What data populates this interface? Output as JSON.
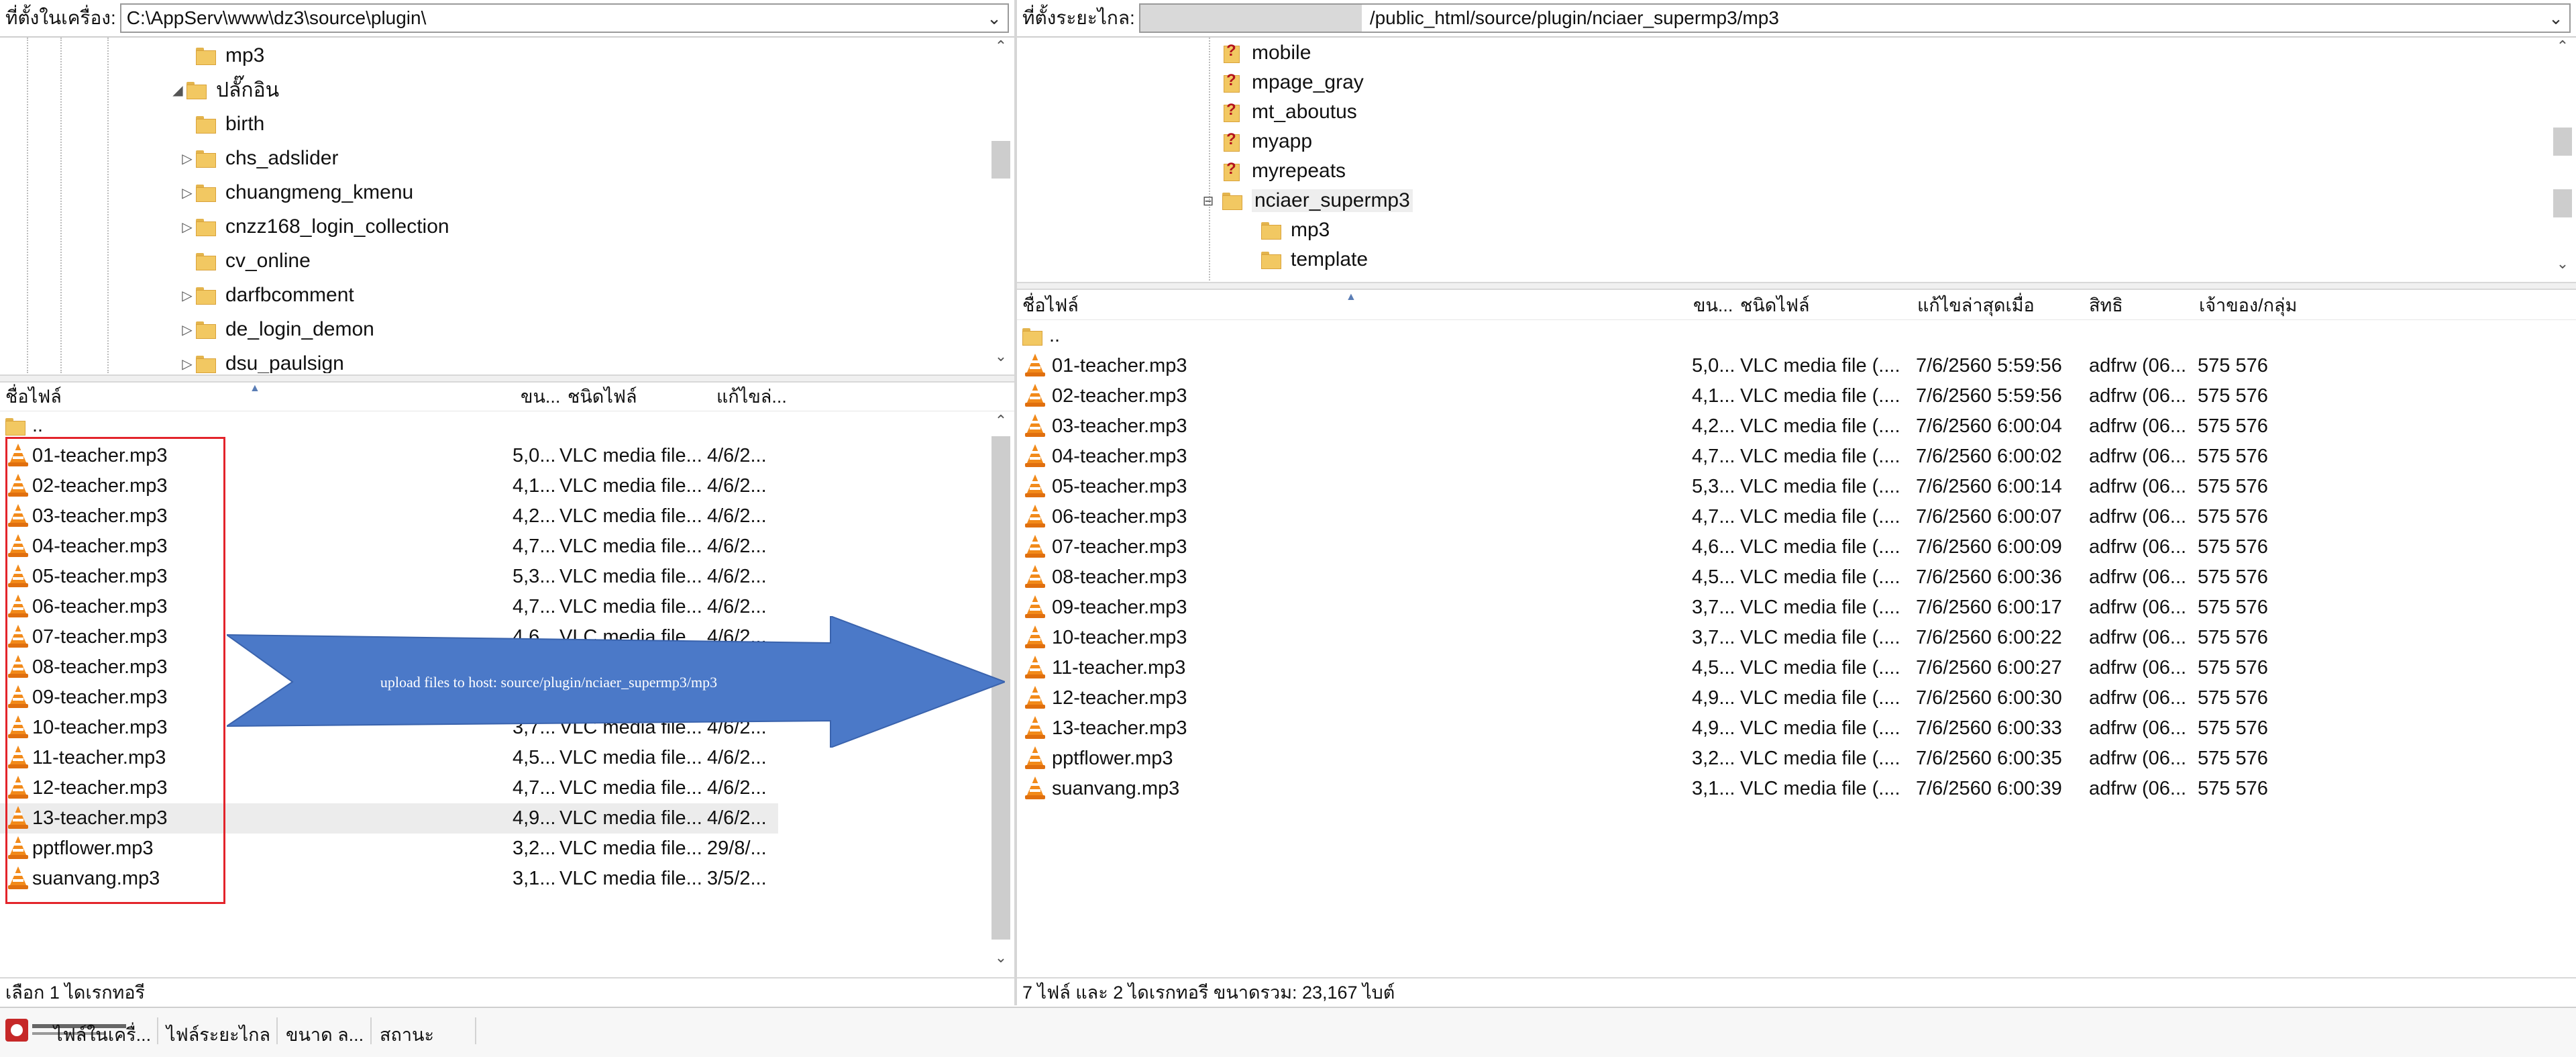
{
  "left": {
    "path_label": "ที่ตั้งในเครื่อง:",
    "path_value": "C:\\AppServ\\www\\dz3\\source\\plugin\\",
    "tree": [
      {
        "label": "mp3",
        "indent": 2,
        "expander": ""
      },
      {
        "label": "ปลั๊กอิน",
        "indent": 1,
        "expander": "◢"
      },
      {
        "label": "birth",
        "indent": 2,
        "expander": ""
      },
      {
        "label": "chs_adslider",
        "indent": 2,
        "expander": "▷"
      },
      {
        "label": "chuangmeng_kmenu",
        "indent": 2,
        "expander": "▷"
      },
      {
        "label": "cnzz168_login_collection",
        "indent": 2,
        "expander": "▷"
      },
      {
        "label": "cv_online",
        "indent": 2,
        "expander": ""
      },
      {
        "label": "darfbcomment",
        "indent": 2,
        "expander": "▷"
      },
      {
        "label": "de_login_demon",
        "indent": 2,
        "expander": "▷"
      },
      {
        "label": "dsu_paulsign",
        "indent": 2,
        "expander": "▷"
      }
    ],
    "columns": {
      "name": "ชื่อไฟล์",
      "size": "ขน...",
      "type": "ชนิดไฟล์",
      "modified": "แก้ไขล่..."
    },
    "parent_dir": "..",
    "files": [
      {
        "name": "01-teacher.mp3",
        "size": "5,0...",
        "type": "VLC media file...",
        "modified": "4/6/2..."
      },
      {
        "name": "02-teacher.mp3",
        "size": "4,1...",
        "type": "VLC media file...",
        "modified": "4/6/2..."
      },
      {
        "name": "03-teacher.mp3",
        "size": "4,2...",
        "type": "VLC media file...",
        "modified": "4/6/2..."
      },
      {
        "name": "04-teacher.mp3",
        "size": "4,7...",
        "type": "VLC media file...",
        "modified": "4/6/2..."
      },
      {
        "name": "05-teacher.mp3",
        "size": "5,3...",
        "type": "VLC media file...",
        "modified": "4/6/2..."
      },
      {
        "name": "06-teacher.mp3",
        "size": "4,7...",
        "type": "VLC media file...",
        "modified": "4/6/2..."
      },
      {
        "name": "07-teacher.mp3",
        "size": "4,6...",
        "type": "VLC media file...",
        "modified": "4/6/2..."
      },
      {
        "name": "08-teacher.mp3",
        "size": "",
        "type": "",
        "modified": ""
      },
      {
        "name": "09-teacher.mp3",
        "size": "",
        "type": "",
        "modified": ""
      },
      {
        "name": "10-teacher.mp3",
        "size": "3,7...",
        "type": "VLC media file...",
        "modified": "4/6/2..."
      },
      {
        "name": "11-teacher.mp3",
        "size": "4,5...",
        "type": "VLC media file...",
        "modified": "4/6/2..."
      },
      {
        "name": "12-teacher.mp3",
        "size": "4,7...",
        "type": "VLC media file...",
        "modified": "4/6/2..."
      },
      {
        "name": "13-teacher.mp3",
        "size": "4,9...",
        "type": "VLC media file...",
        "modified": "4/6/2..."
      },
      {
        "name": "pptflower.mp3",
        "size": "3,2...",
        "type": "VLC media file...",
        "modified": "29/8/..."
      },
      {
        "name": "suanvang.mp3",
        "size": "3,1...",
        "type": "VLC media file...",
        "modified": "3/5/2..."
      }
    ],
    "status": "เลือก 1 ไดเรกทอรี"
  },
  "right": {
    "path_label": "ที่ตั้งระยะไกล:",
    "path_value": "/public_html/source/plugin/nciaer_supermp3/mp3",
    "tree": [
      {
        "label": "mobile",
        "kind": "unknown"
      },
      {
        "label": "mpage_gray",
        "kind": "unknown"
      },
      {
        "label": "mt_aboutus",
        "kind": "unknown"
      },
      {
        "label": "myapp",
        "kind": "unknown"
      },
      {
        "label": "myrepeats",
        "kind": "unknown"
      },
      {
        "label": "nciaer_supermp3",
        "kind": "folder"
      },
      {
        "label": "mp3",
        "kind": "folder"
      },
      {
        "label": "template",
        "kind": "folder"
      }
    ],
    "columns": {
      "name": "ชื่อไฟล์",
      "size": "ขน...",
      "type": "ชนิดไฟล์",
      "modified": "แก้ไขล่าสุดเมื่อ",
      "perms": "สิทธิ",
      "owner": "เจ้าของ/กลุ่ม"
    },
    "parent_dir": "..",
    "files": [
      {
        "name": "01-teacher.mp3",
        "size": "5,0...",
        "type": "VLC media file (....",
        "modified": "7/6/2560 5:59:56",
        "perms": "adfrw (06...",
        "owner": "575 576"
      },
      {
        "name": "02-teacher.mp3",
        "size": "4,1...",
        "type": "VLC media file (....",
        "modified": "7/6/2560 5:59:56",
        "perms": "adfrw (06...",
        "owner": "575 576"
      },
      {
        "name": "03-teacher.mp3",
        "size": "4,2...",
        "type": "VLC media file (....",
        "modified": "7/6/2560 6:00:04",
        "perms": "adfrw (06...",
        "owner": "575 576"
      },
      {
        "name": "04-teacher.mp3",
        "size": "4,7...",
        "type": "VLC media file (....",
        "modified": "7/6/2560 6:00:02",
        "perms": "adfrw (06...",
        "owner": "575 576"
      },
      {
        "name": "05-teacher.mp3",
        "size": "5,3...",
        "type": "VLC media file (....",
        "modified": "7/6/2560 6:00:14",
        "perms": "adfrw (06...",
        "owner": "575 576"
      },
      {
        "name": "06-teacher.mp3",
        "size": "4,7...",
        "type": "VLC media file (....",
        "modified": "7/6/2560 6:00:07",
        "perms": "adfrw (06...",
        "owner": "575 576"
      },
      {
        "name": "07-teacher.mp3",
        "size": "4,6...",
        "type": "VLC media file (....",
        "modified": "7/6/2560 6:00:09",
        "perms": "adfrw (06...",
        "owner": "575 576"
      },
      {
        "name": "08-teacher.mp3",
        "size": "4,5...",
        "type": "VLC media file (....",
        "modified": "7/6/2560 6:00:36",
        "perms": "adfrw (06...",
        "owner": "575 576"
      },
      {
        "name": "09-teacher.mp3",
        "size": "3,7...",
        "type": "VLC media file (....",
        "modified": "7/6/2560 6:00:17",
        "perms": "adfrw (06...",
        "owner": "575 576"
      },
      {
        "name": "10-teacher.mp3",
        "size": "3,7...",
        "type": "VLC media file (....",
        "modified": "7/6/2560 6:00:22",
        "perms": "adfrw (06...",
        "owner": "575 576"
      },
      {
        "name": "11-teacher.mp3",
        "size": "4,5...",
        "type": "VLC media file (....",
        "modified": "7/6/2560 6:00:27",
        "perms": "adfrw (06...",
        "owner": "575 576"
      },
      {
        "name": "12-teacher.mp3",
        "size": "4,9...",
        "type": "VLC media file (....",
        "modified": "7/6/2560 6:00:30",
        "perms": "adfrw (06...",
        "owner": "575 576"
      },
      {
        "name": "13-teacher.mp3",
        "size": "4,9...",
        "type": "VLC media file (....",
        "modified": "7/6/2560 6:00:33",
        "perms": "adfrw (06...",
        "owner": "575 576"
      },
      {
        "name": "pptflower.mp3",
        "size": "3,2...",
        "type": "VLC media file (....",
        "modified": "7/6/2560 6:00:35",
        "perms": "adfrw (06...",
        "owner": "575 576"
      },
      {
        "name": "suanvang.mp3",
        "size": "3,1...",
        "type": "VLC media file (....",
        "modified": "7/6/2560 6:00:39",
        "perms": "adfrw (06...",
        "owner": "575 576"
      }
    ],
    "status": "7 ไฟล์ และ 2 ไดเรกทอรี ขนาดรวม: 23,167 ไบต์"
  },
  "annotation": {
    "arrow_text": "upload files to host: source/plugin/nciaer_supermp3/mp3",
    "arrow_color": "#4b79c8",
    "box_color": "#e3242b"
  },
  "queue": {
    "col1": "ไฟล์ในเครื่...",
    "col2": "ไฟล์ระยะไกล",
    "col3": "ขนาด ล...",
    "col4": "สถานะ"
  }
}
